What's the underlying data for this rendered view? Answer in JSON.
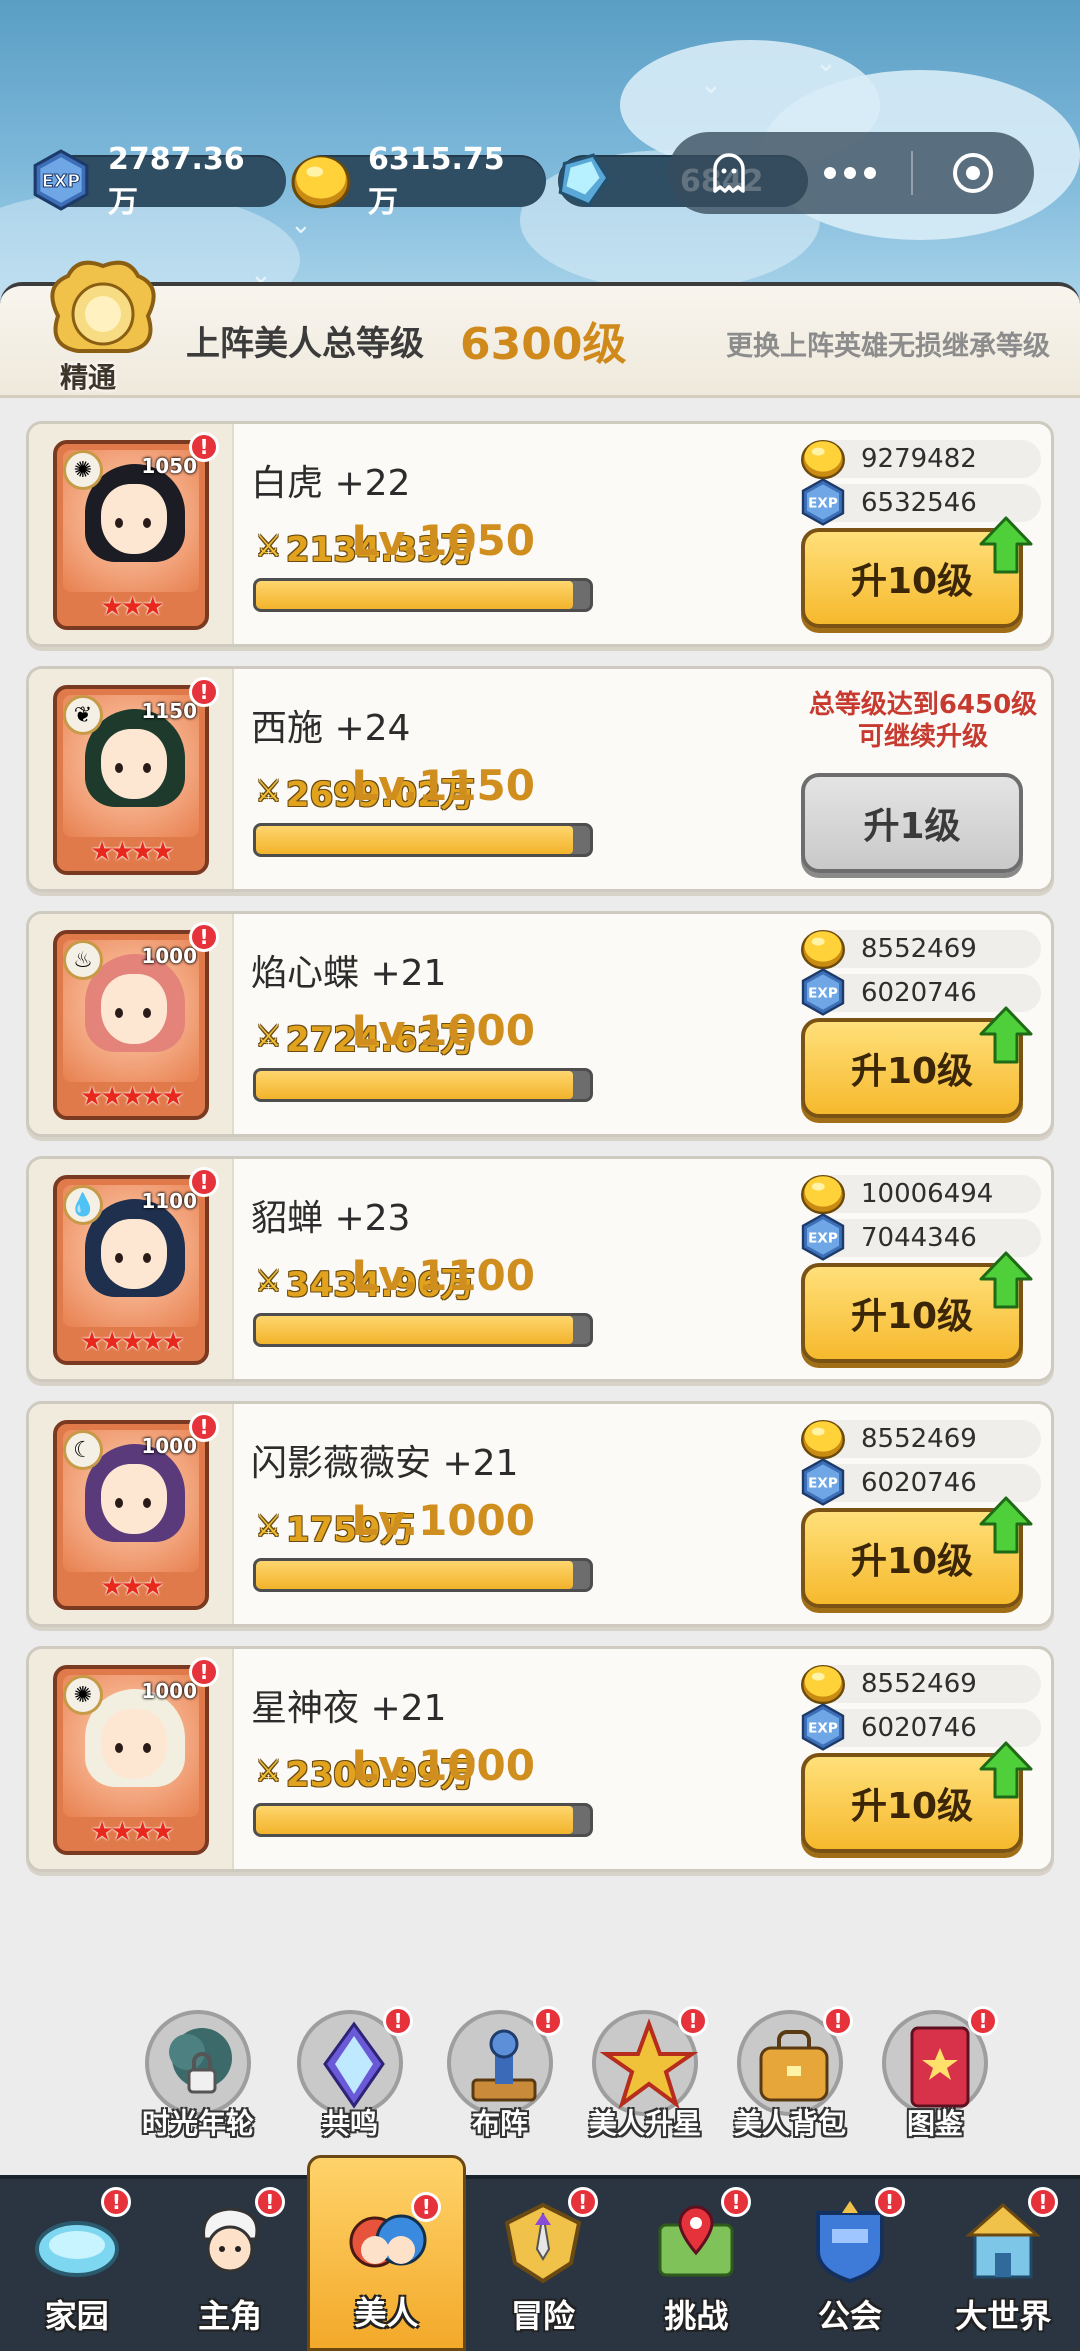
{
  "resources": {
    "exp": "2787.36万",
    "gold": "6315.75万",
    "gem": "6842"
  },
  "summary": {
    "badge": "精通",
    "total_label": "上阵美人总等级",
    "total_value": "6300级",
    "tip": "更换上阵英雄无损继承等级"
  },
  "heroes": [
    {
      "name": "白虎 +22",
      "power": "2134.33万",
      "level": "Lv.1050",
      "lvl_badge": "1050",
      "stars": "★★★",
      "gold": "9279482",
      "exp": "6532546",
      "button": "升10级",
      "progress": 0.95,
      "portrait_color": "#e0784a",
      "hair": "#1c1c24",
      "element": "sun-icon"
    },
    {
      "name": "西施 +24",
      "power": "2699.02万",
      "level": "Lv.1150",
      "lvl_badge": "1150",
      "stars": "★★★★",
      "requirement": "总等级达到6450级\n可继续升级",
      "button": "升1级",
      "progress": 0.95,
      "portrait_color": "#e0784a",
      "hair": "#1d3a2c",
      "element": "leaf-icon"
    },
    {
      "name": "焰心蝶 +21",
      "power": "2724.62万",
      "level": "Lv.1000",
      "lvl_badge": "1000",
      "stars": "★★★★★",
      "gold": "8552469",
      "exp": "6020746",
      "button": "升10级",
      "progress": 0.95,
      "portrait_color": "#e0784a",
      "hair": "#e3837a",
      "element": "fire-icon"
    },
    {
      "name": "貂蝉 +23",
      "power": "3434.96万",
      "level": "Lv.1100",
      "lvl_badge": "1100",
      "stars": "★★★★★",
      "gold": "10006494",
      "exp": "7044346",
      "button": "升10级",
      "progress": 0.95,
      "portrait_color": "#e0784a",
      "hair": "#1f2f4e",
      "element": "water-icon"
    },
    {
      "name": "闪影薇薇安 +21",
      "power": "1759万",
      "level": "Lv.1000",
      "lvl_badge": "1000",
      "stars": "★★★",
      "gold": "8552469",
      "exp": "6020746",
      "button": "升10级",
      "progress": 0.95,
      "portrait_color": "#e0784a",
      "hair": "#5a3a7a",
      "element": "moon-icon"
    },
    {
      "name": "星神夜 +21",
      "power": "2300.99万",
      "level": "Lv.1000",
      "lvl_badge": "1000",
      "stars": "★★★★",
      "gold": "8552469",
      "exp": "6020746",
      "button": "升10级",
      "progress": 0.95,
      "portrait_color": "#e0784a",
      "hair": "#f2efe0",
      "element": "sun-icon"
    }
  ],
  "functions": [
    {
      "label": "时光年轮",
      "icon": "tree-lock-icon"
    },
    {
      "label": "共鸣",
      "icon": "crystal-icon"
    },
    {
      "label": "布阵",
      "icon": "formation-icon"
    },
    {
      "label": "美人升星",
      "icon": "star-up-icon"
    },
    {
      "label": "美人背包",
      "icon": "backpack-icon"
    },
    {
      "label": "图鉴",
      "icon": "book-icon"
    }
  ],
  "nav": [
    {
      "label": "家园",
      "icon": "home-pool-icon"
    },
    {
      "label": "主角",
      "icon": "hero-icon"
    },
    {
      "label": "美人",
      "icon": "beauty-icon"
    },
    {
      "label": "冒险",
      "icon": "sword-emblem-icon"
    },
    {
      "label": "挑战",
      "icon": "map-pin-icon"
    },
    {
      "label": "公会",
      "icon": "guild-shield-icon"
    },
    {
      "label": "大世界",
      "icon": "castle-icon"
    }
  ],
  "colors": {
    "accent_gold": "#f6b92d",
    "level_text": "#cf8e1d",
    "warning": "#c73a30",
    "nav_bg": "#2a3541"
  }
}
